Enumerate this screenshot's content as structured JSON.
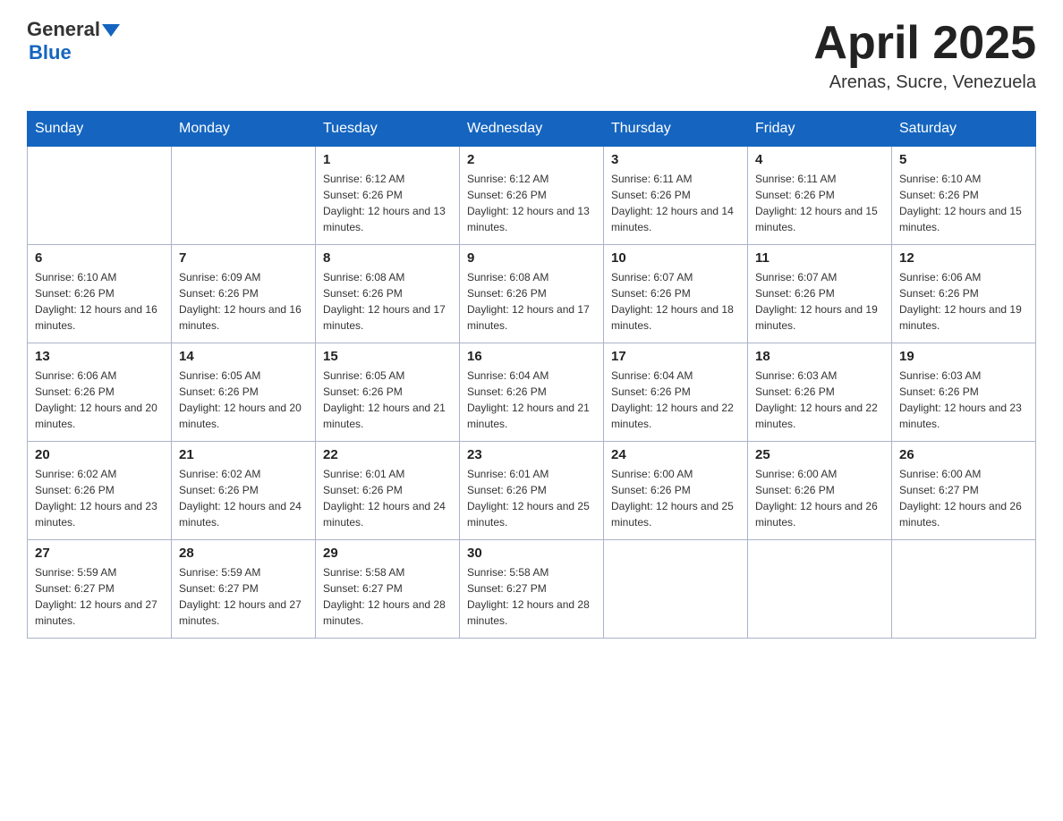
{
  "header": {
    "logo": {
      "text_general": "General",
      "text_blue": "Blue"
    },
    "month_title": "April 2025",
    "location": "Arenas, Sucre, Venezuela"
  },
  "days_of_week": [
    "Sunday",
    "Monday",
    "Tuesday",
    "Wednesday",
    "Thursday",
    "Friday",
    "Saturday"
  ],
  "weeks": [
    [
      {
        "day": "",
        "sunrise": "",
        "sunset": "",
        "daylight": ""
      },
      {
        "day": "",
        "sunrise": "",
        "sunset": "",
        "daylight": ""
      },
      {
        "day": "1",
        "sunrise": "Sunrise: 6:12 AM",
        "sunset": "Sunset: 6:26 PM",
        "daylight": "Daylight: 12 hours and 13 minutes."
      },
      {
        "day": "2",
        "sunrise": "Sunrise: 6:12 AM",
        "sunset": "Sunset: 6:26 PM",
        "daylight": "Daylight: 12 hours and 13 minutes."
      },
      {
        "day": "3",
        "sunrise": "Sunrise: 6:11 AM",
        "sunset": "Sunset: 6:26 PM",
        "daylight": "Daylight: 12 hours and 14 minutes."
      },
      {
        "day": "4",
        "sunrise": "Sunrise: 6:11 AM",
        "sunset": "Sunset: 6:26 PM",
        "daylight": "Daylight: 12 hours and 15 minutes."
      },
      {
        "day": "5",
        "sunrise": "Sunrise: 6:10 AM",
        "sunset": "Sunset: 6:26 PM",
        "daylight": "Daylight: 12 hours and 15 minutes."
      }
    ],
    [
      {
        "day": "6",
        "sunrise": "Sunrise: 6:10 AM",
        "sunset": "Sunset: 6:26 PM",
        "daylight": "Daylight: 12 hours and 16 minutes."
      },
      {
        "day": "7",
        "sunrise": "Sunrise: 6:09 AM",
        "sunset": "Sunset: 6:26 PM",
        "daylight": "Daylight: 12 hours and 16 minutes."
      },
      {
        "day": "8",
        "sunrise": "Sunrise: 6:08 AM",
        "sunset": "Sunset: 6:26 PM",
        "daylight": "Daylight: 12 hours and 17 minutes."
      },
      {
        "day": "9",
        "sunrise": "Sunrise: 6:08 AM",
        "sunset": "Sunset: 6:26 PM",
        "daylight": "Daylight: 12 hours and 17 minutes."
      },
      {
        "day": "10",
        "sunrise": "Sunrise: 6:07 AM",
        "sunset": "Sunset: 6:26 PM",
        "daylight": "Daylight: 12 hours and 18 minutes."
      },
      {
        "day": "11",
        "sunrise": "Sunrise: 6:07 AM",
        "sunset": "Sunset: 6:26 PM",
        "daylight": "Daylight: 12 hours and 19 minutes."
      },
      {
        "day": "12",
        "sunrise": "Sunrise: 6:06 AM",
        "sunset": "Sunset: 6:26 PM",
        "daylight": "Daylight: 12 hours and 19 minutes."
      }
    ],
    [
      {
        "day": "13",
        "sunrise": "Sunrise: 6:06 AM",
        "sunset": "Sunset: 6:26 PM",
        "daylight": "Daylight: 12 hours and 20 minutes."
      },
      {
        "day": "14",
        "sunrise": "Sunrise: 6:05 AM",
        "sunset": "Sunset: 6:26 PM",
        "daylight": "Daylight: 12 hours and 20 minutes."
      },
      {
        "day": "15",
        "sunrise": "Sunrise: 6:05 AM",
        "sunset": "Sunset: 6:26 PM",
        "daylight": "Daylight: 12 hours and 21 minutes."
      },
      {
        "day": "16",
        "sunrise": "Sunrise: 6:04 AM",
        "sunset": "Sunset: 6:26 PM",
        "daylight": "Daylight: 12 hours and 21 minutes."
      },
      {
        "day": "17",
        "sunrise": "Sunrise: 6:04 AM",
        "sunset": "Sunset: 6:26 PM",
        "daylight": "Daylight: 12 hours and 22 minutes."
      },
      {
        "day": "18",
        "sunrise": "Sunrise: 6:03 AM",
        "sunset": "Sunset: 6:26 PM",
        "daylight": "Daylight: 12 hours and 22 minutes."
      },
      {
        "day": "19",
        "sunrise": "Sunrise: 6:03 AM",
        "sunset": "Sunset: 6:26 PM",
        "daylight": "Daylight: 12 hours and 23 minutes."
      }
    ],
    [
      {
        "day": "20",
        "sunrise": "Sunrise: 6:02 AM",
        "sunset": "Sunset: 6:26 PM",
        "daylight": "Daylight: 12 hours and 23 minutes."
      },
      {
        "day": "21",
        "sunrise": "Sunrise: 6:02 AM",
        "sunset": "Sunset: 6:26 PM",
        "daylight": "Daylight: 12 hours and 24 minutes."
      },
      {
        "day": "22",
        "sunrise": "Sunrise: 6:01 AM",
        "sunset": "Sunset: 6:26 PM",
        "daylight": "Daylight: 12 hours and 24 minutes."
      },
      {
        "day": "23",
        "sunrise": "Sunrise: 6:01 AM",
        "sunset": "Sunset: 6:26 PM",
        "daylight": "Daylight: 12 hours and 25 minutes."
      },
      {
        "day": "24",
        "sunrise": "Sunrise: 6:00 AM",
        "sunset": "Sunset: 6:26 PM",
        "daylight": "Daylight: 12 hours and 25 minutes."
      },
      {
        "day": "25",
        "sunrise": "Sunrise: 6:00 AM",
        "sunset": "Sunset: 6:26 PM",
        "daylight": "Daylight: 12 hours and 26 minutes."
      },
      {
        "day": "26",
        "sunrise": "Sunrise: 6:00 AM",
        "sunset": "Sunset: 6:27 PM",
        "daylight": "Daylight: 12 hours and 26 minutes."
      }
    ],
    [
      {
        "day": "27",
        "sunrise": "Sunrise: 5:59 AM",
        "sunset": "Sunset: 6:27 PM",
        "daylight": "Daylight: 12 hours and 27 minutes."
      },
      {
        "day": "28",
        "sunrise": "Sunrise: 5:59 AM",
        "sunset": "Sunset: 6:27 PM",
        "daylight": "Daylight: 12 hours and 27 minutes."
      },
      {
        "day": "29",
        "sunrise": "Sunrise: 5:58 AM",
        "sunset": "Sunset: 6:27 PM",
        "daylight": "Daylight: 12 hours and 28 minutes."
      },
      {
        "day": "30",
        "sunrise": "Sunrise: 5:58 AM",
        "sunset": "Sunset: 6:27 PM",
        "daylight": "Daylight: 12 hours and 28 minutes."
      },
      {
        "day": "",
        "sunrise": "",
        "sunset": "",
        "daylight": ""
      },
      {
        "day": "",
        "sunrise": "",
        "sunset": "",
        "daylight": ""
      },
      {
        "day": "",
        "sunrise": "",
        "sunset": "",
        "daylight": ""
      }
    ]
  ]
}
